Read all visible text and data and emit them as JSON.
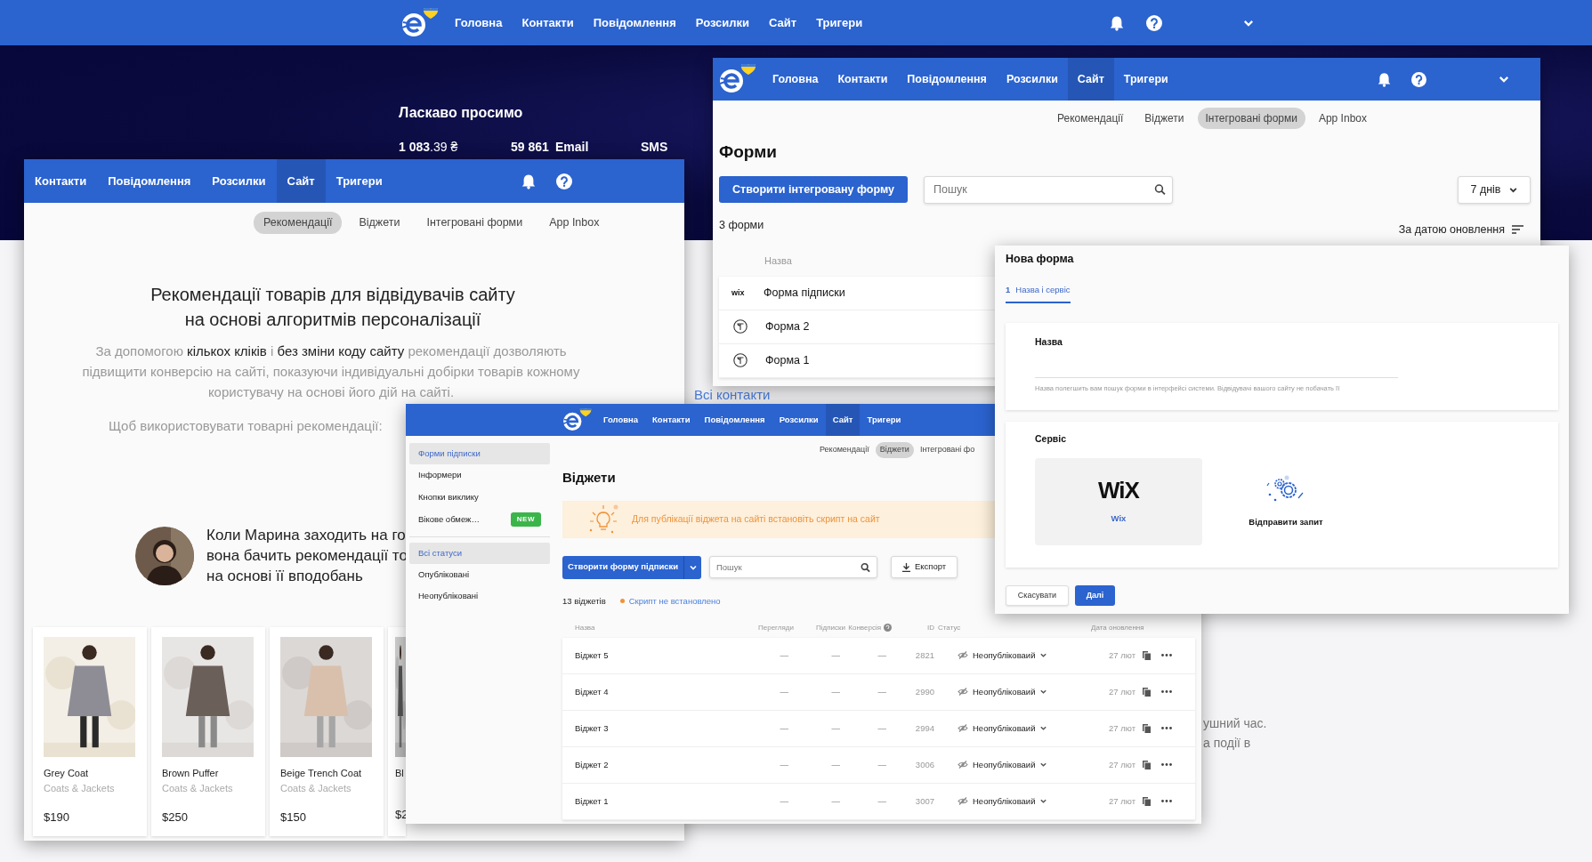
{
  "background": {
    "nav": [
      {
        "label": "Головна",
        "selected": false
      },
      {
        "label": "Контакти",
        "selected": false
      },
      {
        "label": "Повідомлення",
        "selected": false
      },
      {
        "label": "Розсилки",
        "selected": false
      },
      {
        "label": "Сайт",
        "selected": false
      },
      {
        "label": "Тригери",
        "selected": false
      }
    ],
    "welcome": "Ласкаво просимо",
    "balance": "**1 083**.39 ₴",
    "email_count": "59 861",
    "email_label": "Email",
    "sms_label": "SMS",
    "link": "Всі контакти",
    "fragments": [
      "ушний час.",
      "а події в"
    ]
  },
  "recommendations_window": {
    "nav": [
      {
        "label": "Контакти",
        "selected": false
      },
      {
        "label": "Повідомлення",
        "selected": false
      },
      {
        "label": "Розсилки",
        "selected": false
      },
      {
        "label": "Сайт",
        "selected": true
      },
      {
        "label": "Тригери",
        "selected": false
      }
    ],
    "subtabs": [
      {
        "label": "Рекомендації",
        "selected": true
      },
      {
        "label": "Віджети",
        "selected": false
      },
      {
        "label": "Інтегровані форми",
        "selected": false
      },
      {
        "label": "App Inbox",
        "selected": false
      }
    ],
    "heading": [
      "Рекомендації товарів для відвідувачів сайту",
      "на основі алгоритмів персоналізації"
    ],
    "description": "За допомогою **кількох кліків** і **без зміни коду сайту** рекомендації дозволяють підвищити конверсію на сайті, показуючи індивідуальні добірки товарів кожному користувачу на основі його дій на сайті.",
    "prompt": "Щоб використовувати товарні рекомендації:",
    "persona_text": [
      "Коли Марина заходить на го",
      "вона бачить рекомендації то",
      "на основі її вподобань"
    ],
    "products": [
      {
        "name": "Grey Coat",
        "category": "Coats & Jackets",
        "price": "$190"
      },
      {
        "name": "Brown Puffer",
        "category": "Coats & Jackets",
        "price": "$250"
      },
      {
        "name": "Beige Trench Coat",
        "category": "Coats & Jackets",
        "price": "$150"
      },
      {
        "name": "Bl",
        "price": "$2"
      }
    ]
  },
  "forms_window": {
    "nav": [
      {
        "label": "Головна",
        "selected": false
      },
      {
        "label": "Контакти",
        "selected": false
      },
      {
        "label": "Повідомлення",
        "selected": false
      },
      {
        "label": "Розсилки",
        "selected": false
      },
      {
        "label": "Сайт",
        "selected": true
      },
      {
        "label": "Тригери",
        "selected": false
      }
    ],
    "subtabs": [
      {
        "label": "Рекомендації",
        "selected": false
      },
      {
        "label": "Віджети",
        "selected": false
      },
      {
        "label": "Інтегровані форми",
        "selected": true
      },
      {
        "label": "App Inbox",
        "selected": false
      }
    ],
    "title": "Форми",
    "create_button": "Створити інтегровану форму",
    "search": {
      "placeholder": "Пошук"
    },
    "period": "7 днів",
    "count": "3 форми",
    "sort": "За датою оновлення",
    "column": "Назва",
    "rows": [
      {
        "kind": "wix",
        "logo": "wix",
        "name": "Форма підписки"
      },
      {
        "kind": "typeform",
        "name": "Форма 2"
      },
      {
        "kind": "typeform",
        "name": "Форма 1"
      }
    ]
  },
  "widgets_window": {
    "nav": [
      {
        "label": "Головна",
        "selected": false
      },
      {
        "label": "Контакти",
        "selected": false
      },
      {
        "label": "Повідомлення",
        "selected": false
      },
      {
        "label": "Розсилки",
        "selected": false
      },
      {
        "label": "Сайт",
        "selected": true
      },
      {
        "label": "Тригери",
        "selected": false
      }
    ],
    "subtabs": [
      {
        "label": "Рекомендації",
        "selected": false
      },
      {
        "label": "Віджети",
        "selected": true
      },
      {
        "label": "Інтегровані фо",
        "selected": false
      }
    ],
    "sidebar": [
      [
        {
          "label": "Форми підписки",
          "selected": true
        },
        {
          "label": "Інформери",
          "selected": false
        },
        {
          "label": "Кнопки виклику",
          "selected": false
        },
        {
          "label": "Вікове обмеж…",
          "selected": false,
          "badge": "NEW"
        }
      ],
      [
        {
          "label": "Всі статуси",
          "selected": true
        },
        {
          "label": "Опубліковані",
          "selected": false
        },
        {
          "label": "Неопубліковані",
          "selected": false
        }
      ]
    ],
    "title": "Віджети",
    "alert": "Для публікації віджета на сайті встановіть скрипт на сайт",
    "create_button": "Створити форму підписки",
    "search": {
      "placeholder": "Пошук"
    },
    "export": "Експорт",
    "count": "13 віджетів",
    "script_status": "Скрипт не встановлено",
    "columns": [
      "Назва",
      "Перегляди",
      "Підписки",
      "Конверсія",
      "ID",
      "Статус",
      "Дата оновлення"
    ],
    "rows": [
      {
        "name": "Віджет 5",
        "views": "—",
        "subscriptions": "—",
        "conversion": "—",
        "id": "2821",
        "status": "Неопубліковаий",
        "date": "27 лют"
      },
      {
        "name": "Віджет 4",
        "views": "—",
        "subscriptions": "—",
        "conversion": "—",
        "id": "2990",
        "status": "Неопубліковаий",
        "date": "27 лют"
      },
      {
        "name": "Віджет 3",
        "views": "—",
        "subscriptions": "—",
        "conversion": "—",
        "id": "2994",
        "status": "Неопубліковаий",
        "date": "27 лют"
      },
      {
        "name": "Віджет 2",
        "views": "—",
        "subscriptions": "—",
        "conversion": "—",
        "id": "3006",
        "status": "Неопубліковаий",
        "date": "27 лют"
      },
      {
        "name": "Віджет 1",
        "views": "—",
        "subscriptions": "—",
        "conversion": "—",
        "id": "3007",
        "status": "Неопубліковаий",
        "date": "27 лют"
      }
    ]
  },
  "new_form_modal": {
    "title": "Нова форма",
    "steps": [
      {
        "number": "1",
        "label": "Назва і сервіс",
        "selected": true
      }
    ],
    "name_label": "Назва",
    "name_hint": "Назва полегшить вам пошук форми в інтерфейсі системи. Відвідувачі вашого сайту не побачать її",
    "service_label": "Сервіс",
    "services": [
      {
        "kind": "wix",
        "logo": "WiX",
        "label": "Wix",
        "selected": true
      },
      {
        "kind": "request",
        "label": "Відправити запит",
        "selected": false
      }
    ],
    "cancel": "Скасувати",
    "next": "Далі"
  }
}
